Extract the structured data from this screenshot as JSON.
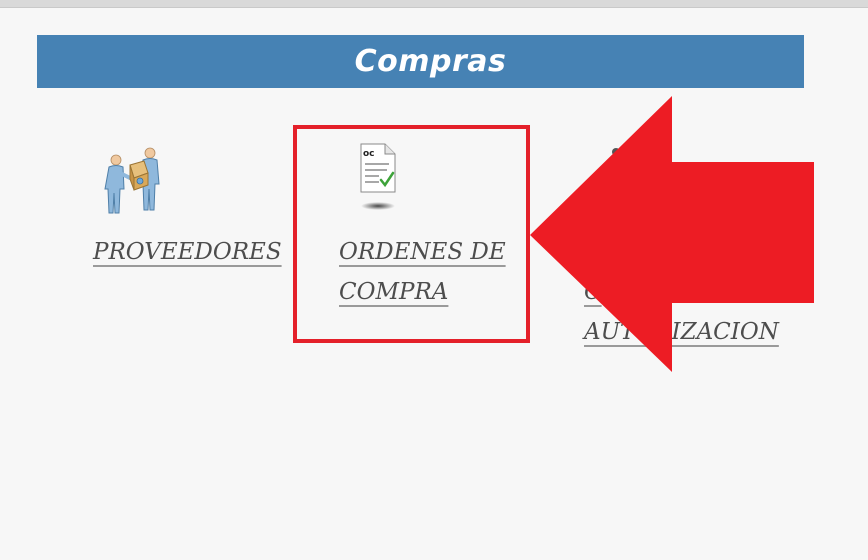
{
  "header": {
    "title": "Compras"
  },
  "menu": {
    "items": [
      {
        "icon": "suppliers-icon",
        "label_lines": [
          "PROVEEDORES"
        ]
      },
      {
        "icon": "purchase-order-icon",
        "label_lines": [
          "ORDENES DE",
          "COMPRA"
        ]
      },
      {
        "icon": "authorization-icon",
        "label_lines": [
          "C",
          "AUTORIZACION"
        ]
      }
    ]
  },
  "colors": {
    "header_bg": "#4682b4",
    "highlight": "#e4202a",
    "arrow": "#ed1c24",
    "page_bg": "#f7f7f7"
  }
}
